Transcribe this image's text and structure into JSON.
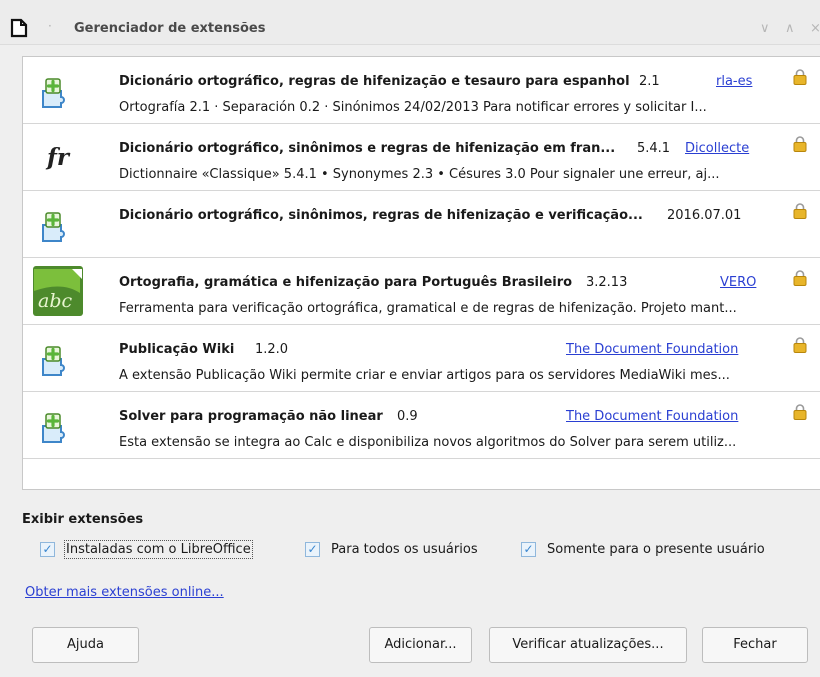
{
  "window": {
    "title": "Gerenciador de extensões",
    "separator": "·",
    "minimize_glyph": "∨",
    "maximize_glyph": "∧",
    "close_glyph": "×"
  },
  "colors": {
    "link": "#2a3fd2",
    "checkbox_check": "#3a86cf",
    "lock_gold": "#d4a017",
    "puzzle_green": "#6cc04a",
    "puzzle_blue": "#3e86c9"
  },
  "extensions": [
    {
      "icon": "puzzle-piece-icon",
      "name": "Dicionário ortográfico, regras de hifenização e tesauro para espanhol",
      "version": "2.1",
      "publisher": "rla-es",
      "locked": true,
      "description": "Ortografía 2.1 · Separación 0.2 · Sinónimos 24/02/2013  Para notificar errores y solicitar I..."
    },
    {
      "icon": "fr-language-icon",
      "icon_text": "fr",
      "name": "Dicionário ortográfico, sinônimos e regras de hifenização em fran...",
      "version": "5.4.1",
      "publisher": "Dicollecte",
      "locked": true,
      "description": "Dictionnaire «Classique» 5.4.1 • Synonymes 2.3 • Césures 3.0   Pour signaler une erreur, aj..."
    },
    {
      "icon": "puzzle-piece-icon",
      "name": "Dicionário ortográfico, sinônimos, regras de hifenização e verificação...",
      "version": "2016.07.01",
      "publisher": "",
      "locked": true,
      "description": ""
    },
    {
      "icon": "abc-vero-icon",
      "icon_text": "abc",
      "name": "Ortografia, gramática e hifenização para Português Brasileiro",
      "version": "3.2.13",
      "publisher": "VERO",
      "locked": true,
      "description": "Ferramenta para verificação ortográfica, gramatical e de regras de hifenização. Projeto mant..."
    },
    {
      "icon": "puzzle-piece-icon",
      "name": "Publicação Wiki",
      "version": "1.2.0",
      "publisher": "The Document Foundation",
      "locked": true,
      "description": "A extensão Publicação Wiki permite criar e enviar artigos para os servidores MediaWiki mes..."
    },
    {
      "icon": "puzzle-piece-icon",
      "name": "Solver para programação não linear",
      "version": "0.9",
      "publisher": "The Document Foundation",
      "locked": true,
      "description": "Esta extensão se integra ao Calc e disponibiliza novos algoritmos do Solver para serem utiliz..."
    }
  ],
  "filter": {
    "section_label": "Exibir extensões",
    "options": [
      {
        "label": "Instaladas com o LibreOffice",
        "checked": true
      },
      {
        "label": "Para todos os usuários",
        "checked": true
      },
      {
        "label": "Somente para o presente usuário",
        "checked": true
      }
    ]
  },
  "online_link": "Obter mais extensões online...",
  "buttons": {
    "help": "Ajuda",
    "add": "Adicionar...",
    "check_updates": "Verificar atualizações...",
    "close": "Fechar"
  }
}
